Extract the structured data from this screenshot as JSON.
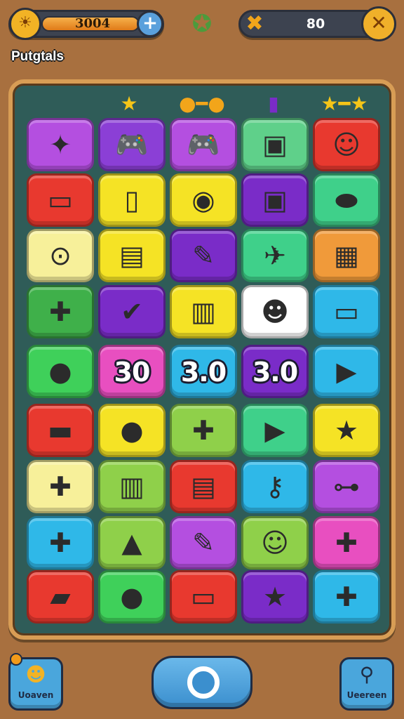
{
  "header": {
    "coins": "3004",
    "coin_icon": "sun-coin-icon",
    "add_icon": "plus-icon",
    "center_badge_icon": "star-badge-icon",
    "energy": "80",
    "energy_icon": "tools-icon",
    "close_icon": "close-icon"
  },
  "page_title": "Putgtals",
  "board": {
    "decor": [
      "★",
      "●━●",
      "▮",
      "★━★"
    ],
    "tiles": [
      {
        "color": "#b44fe0",
        "icon": "banner-icon",
        "glyph": "✦"
      },
      {
        "color": "#8b3fd6",
        "icon": "gamepad-icon",
        "glyph": "🎮"
      },
      {
        "color": "#b44fe0",
        "icon": "gamepad-color-icon",
        "glyph": "🎮"
      },
      {
        "color": "#5fd08a",
        "icon": "camera-card-icon",
        "glyph": "▣"
      },
      {
        "color": "#e8392f",
        "icon": "smiley-console-icon",
        "glyph": "☺"
      },
      {
        "color": "#e8392f",
        "icon": "cash-icon",
        "glyph": "▭"
      },
      {
        "color": "#f5e325",
        "icon": "phone-icon",
        "glyph": "▯"
      },
      {
        "color": "#f5e325",
        "icon": "check-coin-icon",
        "glyph": "◉"
      },
      {
        "color": "#7a2cc8",
        "icon": "camera-icon",
        "glyph": "▣"
      },
      {
        "color": "#3fd08a",
        "icon": "capsule-icon",
        "glyph": "⬬"
      },
      {
        "color": "#f7f09a",
        "icon": "joystick-icon",
        "glyph": "⊙"
      },
      {
        "color": "#f5e325",
        "icon": "handheld-icon",
        "glyph": "▤"
      },
      {
        "color": "#7a2cc8",
        "icon": "marker-icon",
        "glyph": "✎"
      },
      {
        "color": "#3fd08a",
        "icon": "plane-toy-icon",
        "glyph": "✈"
      },
      {
        "color": "#f09a3a",
        "icon": "device-icon",
        "glyph": "▦"
      },
      {
        "color": "#3fb04a",
        "icon": "gamepad-red-icon",
        "glyph": "✚"
      },
      {
        "color": "#7a2cc8",
        "icon": "cart-icon",
        "glyph": "✔"
      },
      {
        "color": "#f5e325",
        "icon": "printer-icon",
        "glyph": "▥"
      },
      {
        "color": "#ffffff",
        "icon": "face-icon",
        "glyph": "☻"
      },
      {
        "color": "#2fb8e8",
        "icon": "suitcase-icon",
        "glyph": "▭"
      },
      {
        "color": "#3fd05a",
        "icon": "candy-icon",
        "glyph": "●",
        "num": ""
      },
      {
        "color": "#e84fc0",
        "icon": "number-tile-icon",
        "glyph": "",
        "num": "30"
      },
      {
        "color": "#2fb8e8",
        "icon": "number-tile-icon",
        "glyph": "",
        "num": "3.0"
      },
      {
        "color": "#7a2cc8",
        "icon": "number-tile-icon",
        "glyph": "",
        "num": "3.0"
      },
      {
        "color": "#2fb8e8",
        "icon": "play-case-icon",
        "glyph": "▶"
      },
      {
        "color": "#e8392f",
        "icon": "blue-case-icon",
        "glyph": "▬"
      },
      {
        "color": "#f5e325",
        "icon": "red-bag-icon",
        "glyph": "●"
      },
      {
        "color": "#8fd04a",
        "icon": "gamepad-green-icon",
        "glyph": "✚"
      },
      {
        "color": "#3fd08a",
        "icon": "video-play-icon",
        "glyph": "▶"
      },
      {
        "color": "#f5e325",
        "icon": "star-icon",
        "glyph": "★"
      },
      {
        "color": "#f7f09a",
        "icon": "gamepad-orange-icon",
        "glyph": "✚"
      },
      {
        "color": "#8fd04a",
        "icon": "fries-icon",
        "glyph": "▥"
      },
      {
        "color": "#e8392f",
        "icon": "console-icon",
        "glyph": "▤"
      },
      {
        "color": "#2fb8e8",
        "icon": "key-icon",
        "glyph": "⚷"
      },
      {
        "color": "#b44fe0",
        "icon": "car-icon",
        "glyph": "⊶"
      },
      {
        "color": "#2fb8e8",
        "icon": "controller-icon",
        "glyph": "✚"
      },
      {
        "color": "#8fd04a",
        "icon": "bell-icon",
        "glyph": "▲"
      },
      {
        "color": "#b44fe0",
        "icon": "pencil-icon",
        "glyph": "✎"
      },
      {
        "color": "#8fd04a",
        "icon": "emoji-icon",
        "glyph": "☺"
      },
      {
        "color": "#e84fc0",
        "icon": "gamepad-white-icon",
        "glyph": "✚"
      },
      {
        "color": "#e8392f",
        "icon": "ticket-icon",
        "glyph": "▰"
      },
      {
        "color": "#3fd05a",
        "icon": "orange-ball-icon",
        "glyph": "●"
      },
      {
        "color": "#e8392f",
        "icon": "tablet-icon",
        "glyph": "▭"
      },
      {
        "color": "#7a2cc8",
        "icon": "star-gold-icon",
        "glyph": "★"
      },
      {
        "color": "#2fb8e8",
        "icon": "gamepad-black-icon",
        "glyph": "✚"
      }
    ]
  },
  "bottom": {
    "left_label": "Uoaven",
    "left_icon": "medal-icon",
    "center_icon": "ring-button-icon",
    "right_label": "Ueereen",
    "right_icon": "magnifier-icon"
  }
}
